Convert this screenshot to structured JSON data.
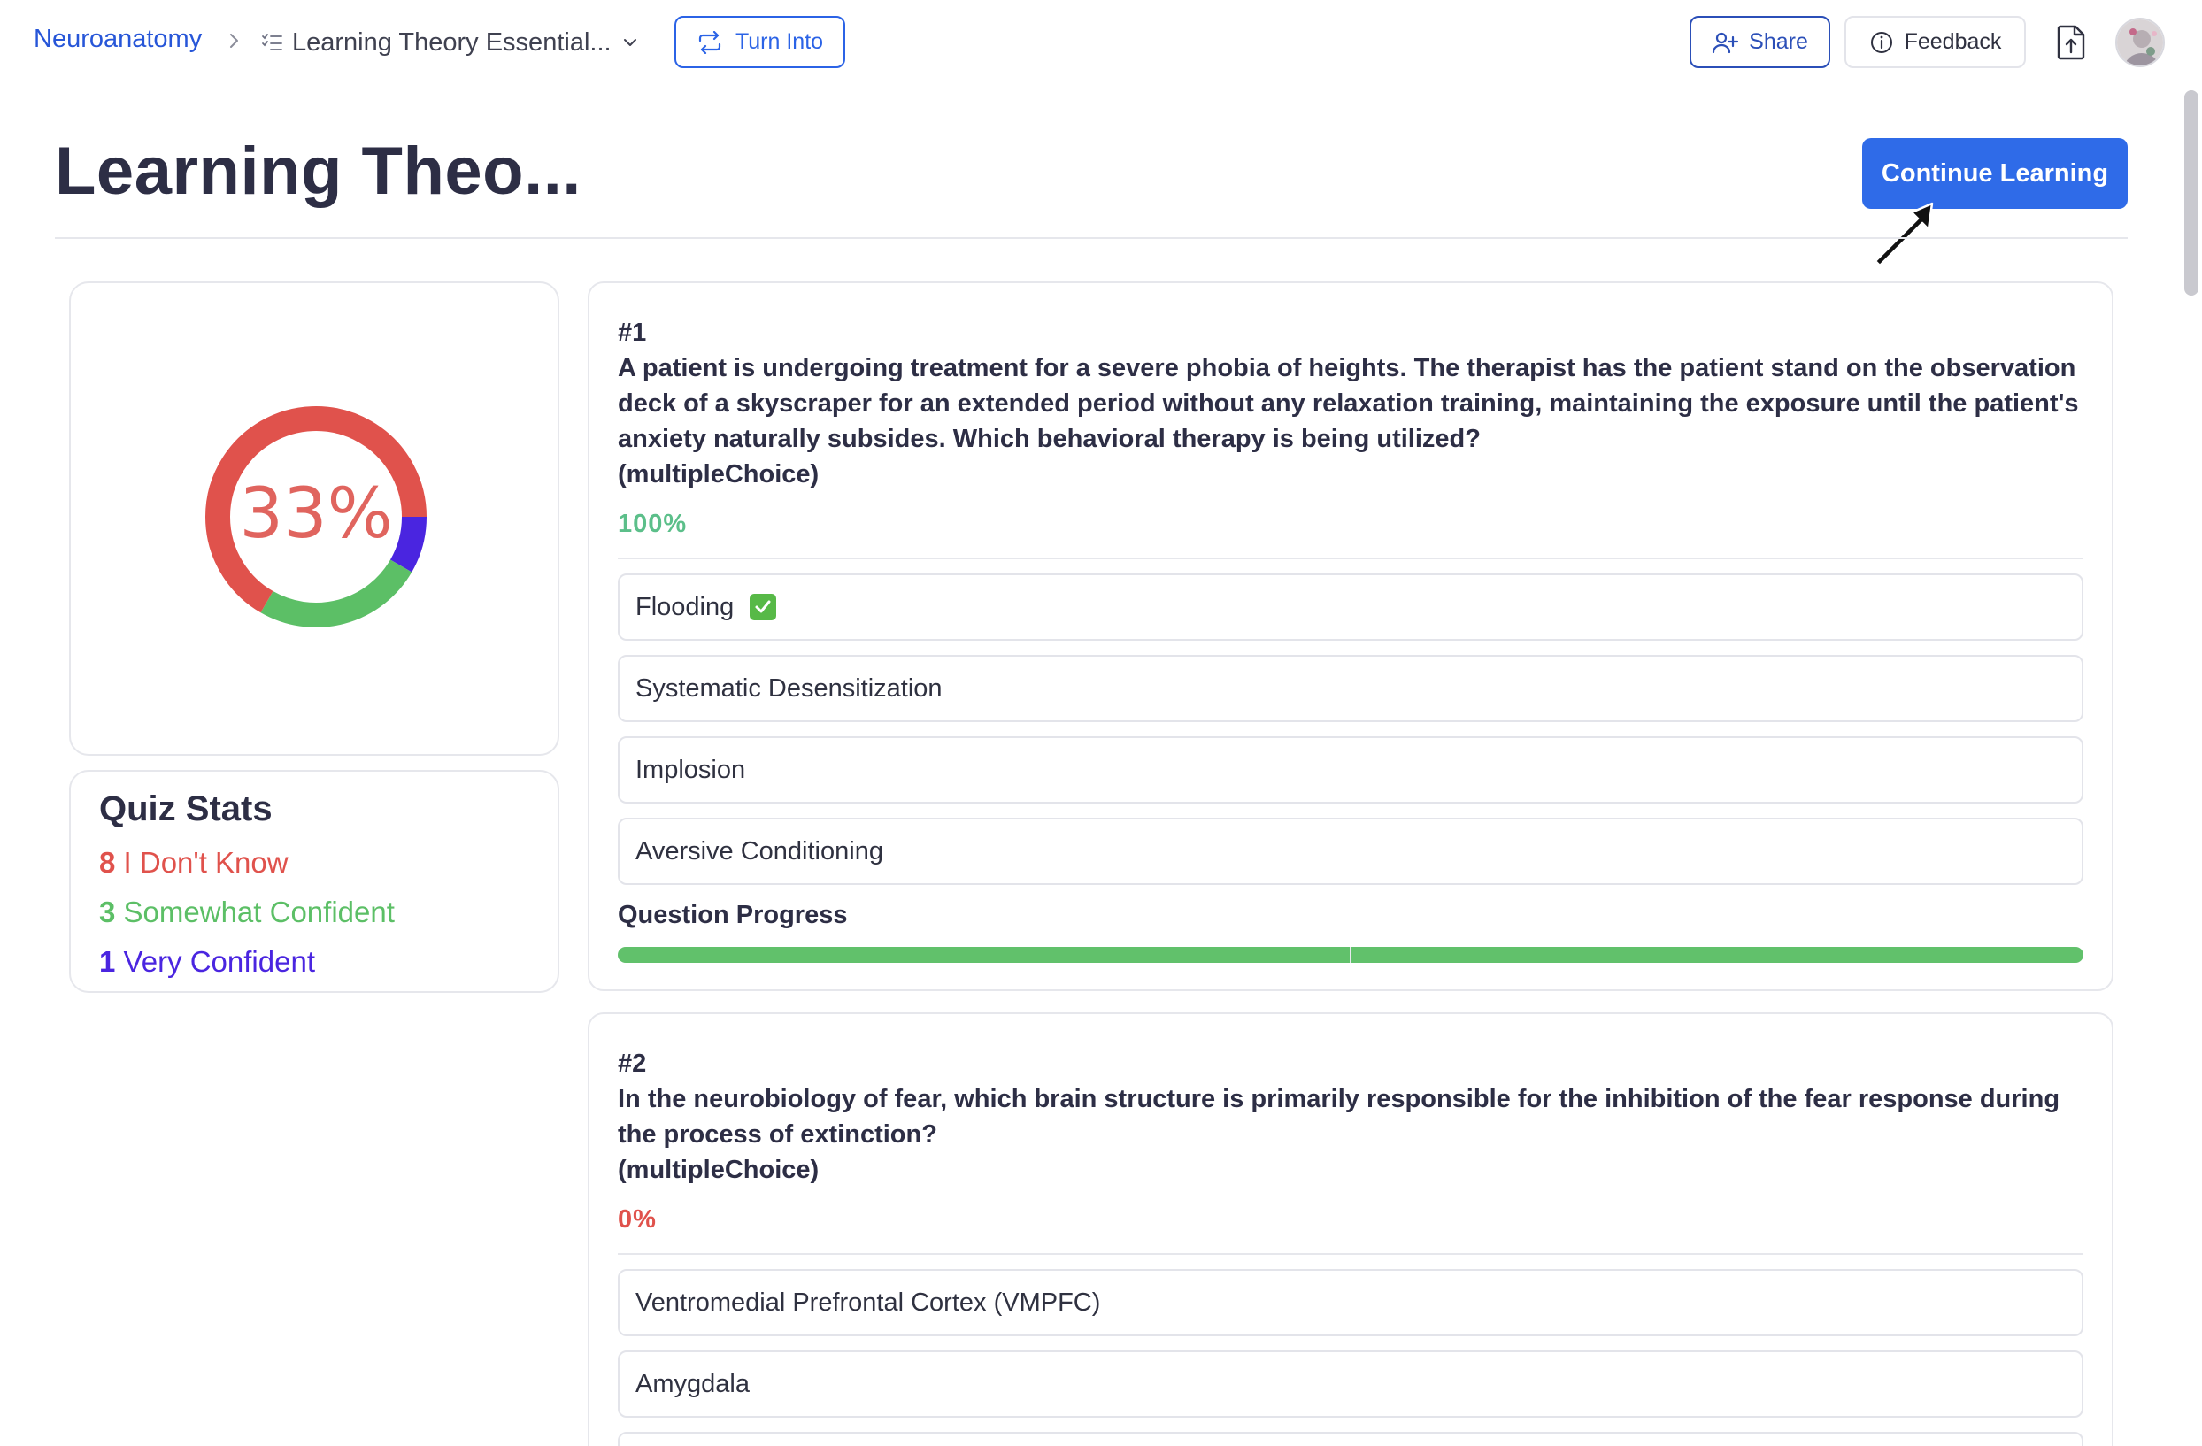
{
  "breadcrumb": {
    "root": "Neuroanatomy",
    "current": "Learning Theory Essential..."
  },
  "toolbar": {
    "turn_into_label": "Turn Into",
    "share_label": "Share",
    "feedback_label": "Feedback"
  },
  "page": {
    "title": "Learning Theo...",
    "continue_label": "Continue Learning"
  },
  "donut": {
    "label": "33%",
    "segments": [
      {
        "name": "I Don't Know",
        "count": 8,
        "color": "#e0524c"
      },
      {
        "name": "Somewhat Confident",
        "count": 3,
        "color": "#5cbf66"
      },
      {
        "name": "Very Confident",
        "count": 1,
        "color": "#4a25e0"
      }
    ]
  },
  "stats": {
    "title": "Quiz Stats",
    "dont_know_count": "8",
    "dont_know_label": " I Don't Know",
    "somewhat_count": "3",
    "somewhat_label": " Somewhat Confident",
    "very_count": "1",
    "very_label": " Very Confident"
  },
  "questions": [
    {
      "number": "#1",
      "text": "A patient is undergoing treatment for a severe phobia of heights. The therapist has the patient stand on the observation deck of a skyscraper for an extended period without any relaxation training, maintaining the exposure until the patient's anxiety naturally subsides. Which behavioral therapy is being utilized?",
      "type": "(multipleChoice)",
      "score": "100%",
      "options": [
        "Flooding",
        "Systematic Desensitization",
        "Implosion",
        "Aversive Conditioning"
      ],
      "correct_index": 0,
      "progress_label": "Question Progress",
      "progress_segments": 2,
      "progress_completed": 2
    },
    {
      "number": "#2",
      "text": "In the neurobiology of fear, which brain structure is primarily responsible for the inhibition of the fear response during the process of extinction?",
      "type": "(multipleChoice)",
      "score": "0%",
      "options": [
        "Ventromedial Prefrontal Cortex (VMPFC)",
        "Amygdala"
      ]
    }
  ],
  "colors": {
    "accent": "#2f6be8",
    "red": "#e0524c",
    "green": "#5cbf66",
    "purple": "#4a25e0"
  },
  "icons": [
    "chevron-right-icon",
    "list-icon",
    "chevron-down-icon",
    "repeat-icon",
    "user-plus-icon",
    "info-icon",
    "file-export-icon",
    "check-icon",
    "cursor-arrow-icon"
  ]
}
